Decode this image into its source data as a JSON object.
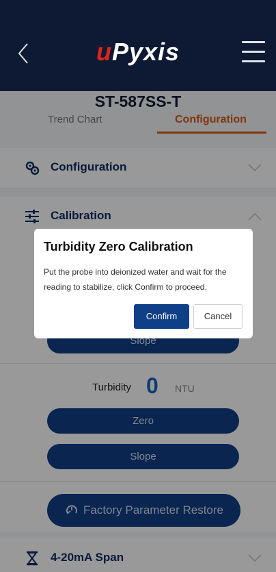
{
  "app": {
    "logo_u": "u",
    "logo_rest": "Pyxis",
    "device_name": "ST-587SS-T"
  },
  "tabs": [
    {
      "label": "Trend Chart",
      "active": false
    },
    {
      "label": "Configuration",
      "active": true
    }
  ],
  "sections": {
    "configuration": {
      "label": "Configuration",
      "icon": "gear-cluster-icon",
      "expanded": false
    },
    "calibration": {
      "label": "Calibration",
      "icon": "sliders-icon",
      "expanded": true
    },
    "span": {
      "label": "4-20mA Span",
      "icon": "hourglass-icon",
      "expanded": false
    }
  },
  "calibration": {
    "slope_upper_label": "Slope",
    "turbidity_label": "Turbidity",
    "turbidity_value": "0",
    "turbidity_unit": "NTU",
    "zero_label": "Zero",
    "slope_label": "Slope",
    "restore_label": "Factory Parameter Restore"
  },
  "dialog": {
    "title": "Turbidity Zero Calibration",
    "message": "Put the probe into deionized water and wait for the reading to stabilize, click Confirm to proceed.",
    "confirm_label": "Confirm",
    "cancel_label": "Cancel"
  },
  "colors": {
    "header_bg": "#0e1a33",
    "brand_red": "#e0241b",
    "accent_orange": "#d55a17",
    "primary_blue": "#0f3f86",
    "value_blue": "#1565c0"
  }
}
